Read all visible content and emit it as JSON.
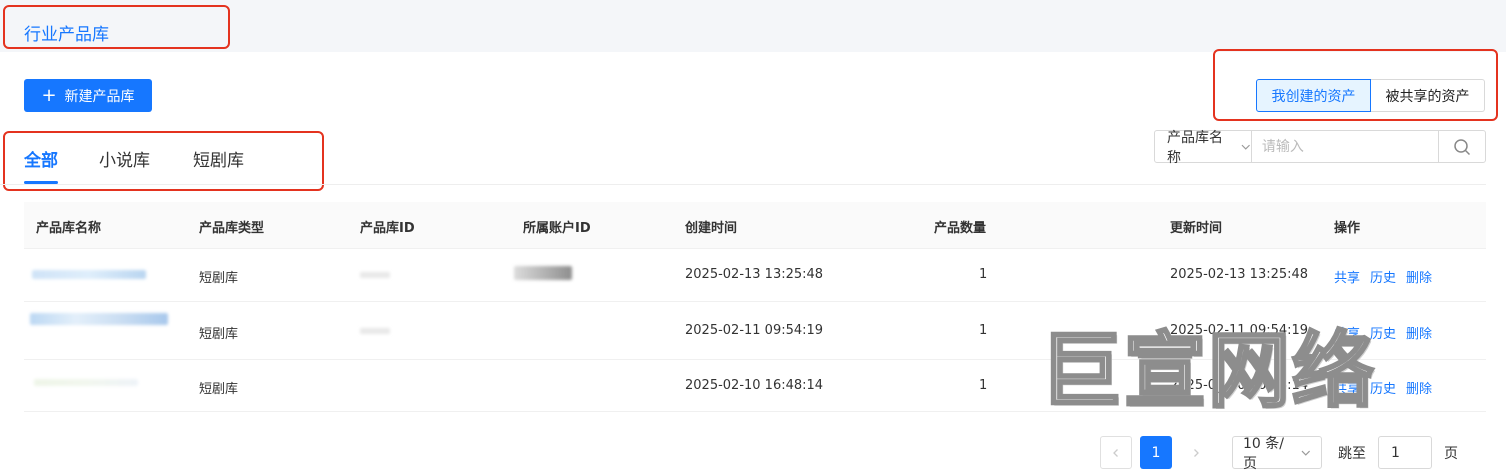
{
  "header": {
    "title": "行业产品库"
  },
  "toolbar": {
    "new_button_icon": "+",
    "new_button_label": "新建产品库"
  },
  "asset_toggle": {
    "mine": "我创建的资产",
    "shared": "被共享的资产",
    "active": "mine"
  },
  "tabs": [
    {
      "label": "全部",
      "active": true
    },
    {
      "label": "小说库",
      "active": false
    },
    {
      "label": "短剧库",
      "active": false
    }
  ],
  "search": {
    "field": "产品库名称",
    "placeholder": "请输入"
  },
  "table": {
    "columns": [
      "产品库名称",
      "产品库类型",
      "产品库ID",
      "所属账户ID",
      "创建时间",
      "产品数量",
      "更新时间",
      "操作"
    ],
    "rows": [
      {
        "type": "短剧库",
        "created": "2025-02-13 13:25:48",
        "count": "1",
        "updated": "2025-02-13 13:25:48"
      },
      {
        "type": "短剧库",
        "created": "2025-02-11 09:54:19",
        "count": "1",
        "updated": "2025-02-11 09:54:19"
      },
      {
        "type": "短剧库",
        "created": "2025-02-10 16:48:14",
        "count": "1",
        "updated": "2025-02-10 16:48:14"
      }
    ],
    "actions": [
      "共享",
      "历史",
      "删除"
    ]
  },
  "pagination": {
    "current": "1",
    "page_size": "10 条/页",
    "jump_label": "跳至",
    "jump_value": "1",
    "page_suffix": "页"
  },
  "watermark": {
    "text": "巨宣网络"
  },
  "colors": {
    "primary": "#1677ff",
    "annotation": "#e4331f"
  }
}
